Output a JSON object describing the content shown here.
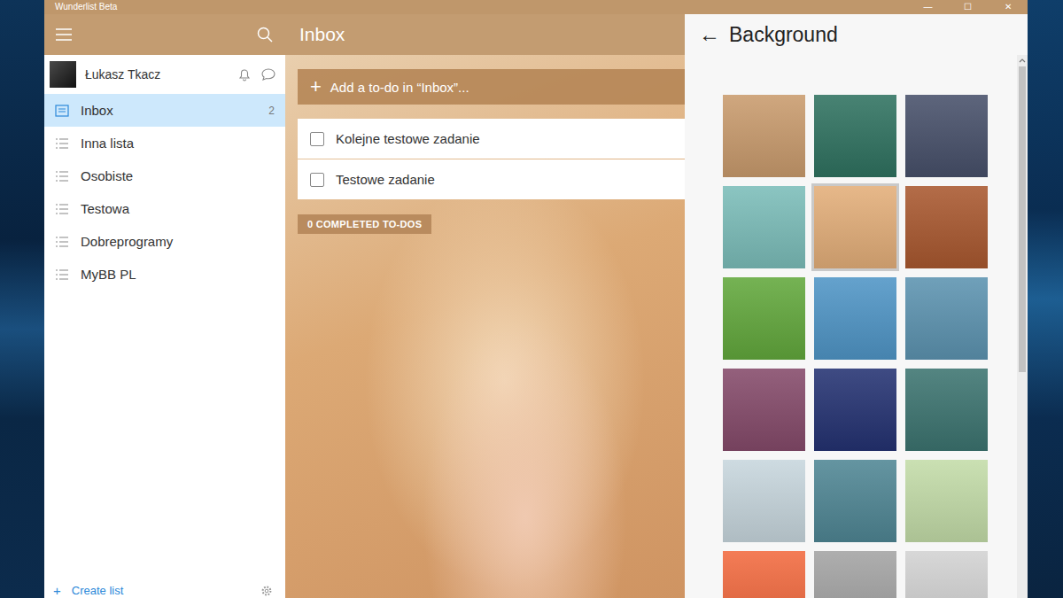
{
  "window": {
    "title": "Wunderlist Beta",
    "controls": [
      "—",
      "☐",
      "✕"
    ]
  },
  "user": {
    "name": "Łukasz Tkacz"
  },
  "sidebar": {
    "items": [
      {
        "label": "Inbox",
        "kind": "inbox",
        "count": "2",
        "selected": true
      },
      {
        "label": "Inna lista",
        "kind": "list",
        "selected": false
      },
      {
        "label": "Osobiste",
        "kind": "list",
        "selected": false
      },
      {
        "label": "Testowa",
        "kind": "list",
        "selected": false
      },
      {
        "label": "Dobreprogramy",
        "kind": "list",
        "selected": false
      },
      {
        "label": "MyBB PL",
        "kind": "list",
        "selected": false
      }
    ],
    "create_list": {
      "icon": "+",
      "label": "Create list"
    }
  },
  "list": {
    "title": "Inbox",
    "add": {
      "icon": "+",
      "placeholder": "Add a to-do in “Inbox”..."
    },
    "todos": [
      {
        "label": "Kolejne testowe zadanie",
        "checked": false
      },
      {
        "label": "Testowe zadanie",
        "checked": false
      }
    ],
    "completed": "0 COMPLETED TO-DOS"
  },
  "background_panel": {
    "back": "←",
    "title": "Background",
    "options": [
      {
        "color": "#c99b6d",
        "selected": false
      },
      {
        "color": "#2f7260",
        "selected": false
      },
      {
        "color": "#47506a",
        "selected": false
      },
      {
        "color": "#7bbdb9",
        "selected": false
      },
      {
        "color": "#e3ae79",
        "selected": true
      },
      {
        "color": "#a9582f",
        "selected": false
      },
      {
        "color": "#62a83c",
        "selected": false
      },
      {
        "color": "#4f95c6",
        "selected": false
      },
      {
        "color": "#5c93b0",
        "selected": false
      },
      {
        "color": "#854a6a",
        "selected": false
      },
      {
        "color": "#243272",
        "selected": false
      },
      {
        "color": "#3c7470",
        "selected": false
      },
      {
        "color": "#c7d6dd",
        "selected": false
      },
      {
        "color": "#4f8694",
        "selected": false
      },
      {
        "color": "#c3dca8",
        "selected": false
      },
      {
        "color": "#f26a3f",
        "selected": false
      },
      {
        "color": "#a3a3a3",
        "selected": false
      },
      {
        "color": "#d2d2d2",
        "selected": false
      }
    ]
  }
}
